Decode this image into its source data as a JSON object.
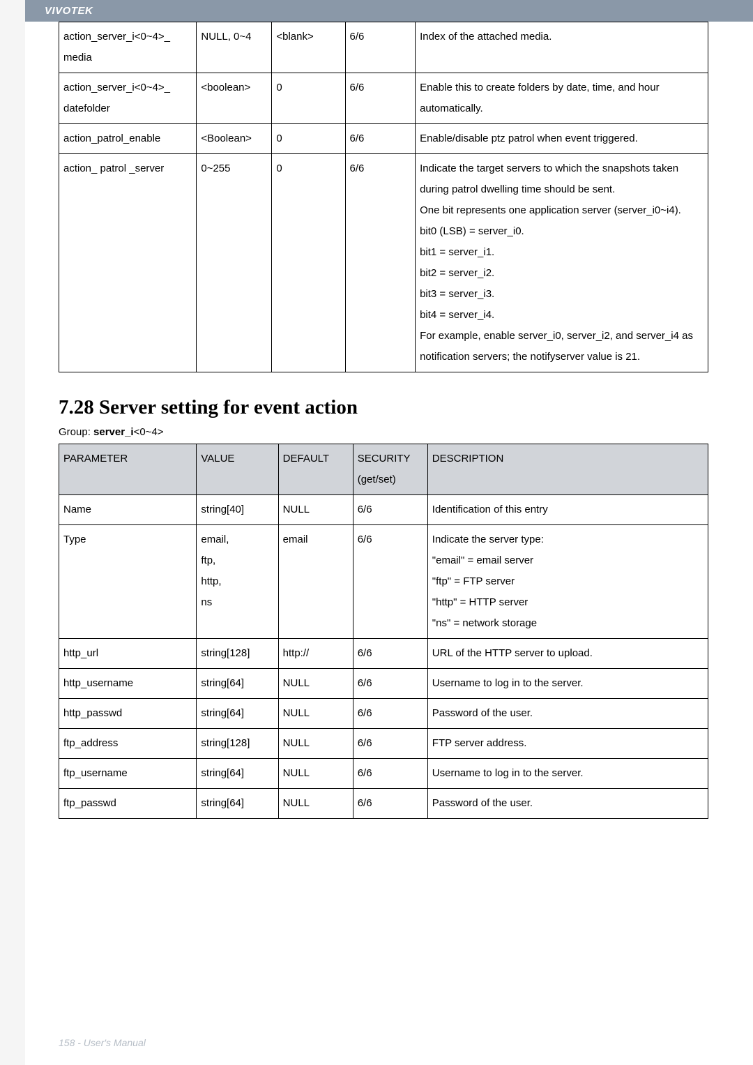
{
  "brand": "VIVOTEK",
  "table1": {
    "rows": [
      {
        "param": "action_server_i<0~4>_ media",
        "value": "NULL, 0~4",
        "default": "<blank>",
        "security": "6/6",
        "desc": "Index of the attached media."
      },
      {
        "param": "action_server_i<0~4>_ datefolder",
        "value": "<boolean>",
        "default": "0",
        "security": "6/6",
        "desc": "Enable this to create folders by date, time, and hour automatically."
      },
      {
        "param": "action_patrol_enable",
        "value": "<Boolean>",
        "default": "0",
        "security": "6/6",
        "desc": "Enable/disable ptz patrol when event triggered."
      },
      {
        "param": "action_ patrol _server",
        "value": "0~255",
        "default": "0",
        "security": "6/6",
        "desc": "Indicate the target servers to which the snapshots taken during patrol dwelling time should be sent.\nOne bit represents one application server (server_i0~i4).\nbit0 (LSB) = server_i0.\nbit1 = server_i1.\nbit2 = server_i2.\nbit3 = server_i3.\nbit4 = server_i4.\nFor example, enable server_i0, server_i2, and server_i4 as notification servers; the notifyserver value is 21."
      }
    ]
  },
  "sectionHeading": "7.28 Server setting for event action",
  "groupLabel": "Group: ",
  "groupValueBold": "server_i",
  "groupValueTail": "<0~4>",
  "table2": {
    "headers": [
      "PARAMETER",
      "VALUE",
      "DEFAULT",
      "SECURITY (get/set)",
      "DESCRIPTION"
    ],
    "rows": [
      {
        "param": "Name",
        "value": "string[40]",
        "default": "NULL",
        "security": "6/6",
        "desc": "Identification of this entry"
      },
      {
        "param": "Type",
        "value": "email,\nftp,\nhttp,\nns",
        "default": "email",
        "security": "6/6",
        "desc": "Indicate the server type:\n\"email\" = email server\n\"ftp\" = FTP server\n\"http\" = HTTP server\n\"ns\" = network storage"
      },
      {
        "param": "http_url",
        "value": "string[128]",
        "default": "http://",
        "security": "6/6",
        "desc": "URL of the HTTP server to upload."
      },
      {
        "param": "http_username",
        "value": "string[64]",
        "default": "NULL",
        "security": "6/6",
        "desc": "Username to log in to the server."
      },
      {
        "param": "http_passwd",
        "value": "string[64]",
        "default": "NULL",
        "security": "6/6",
        "desc": "Password of the user."
      },
      {
        "param": "ftp_address",
        "value": "string[128]",
        "default": "NULL",
        "security": "6/6",
        "desc": "FTP server address."
      },
      {
        "param": "ftp_username",
        "value": "string[64]",
        "default": "NULL",
        "security": "6/6",
        "desc": "Username to log in to the server."
      },
      {
        "param": "ftp_passwd",
        "value": "string[64]",
        "default": "NULL",
        "security": "6/6",
        "desc": "Password of the user."
      }
    ]
  },
  "footer": "158 - User's Manual"
}
